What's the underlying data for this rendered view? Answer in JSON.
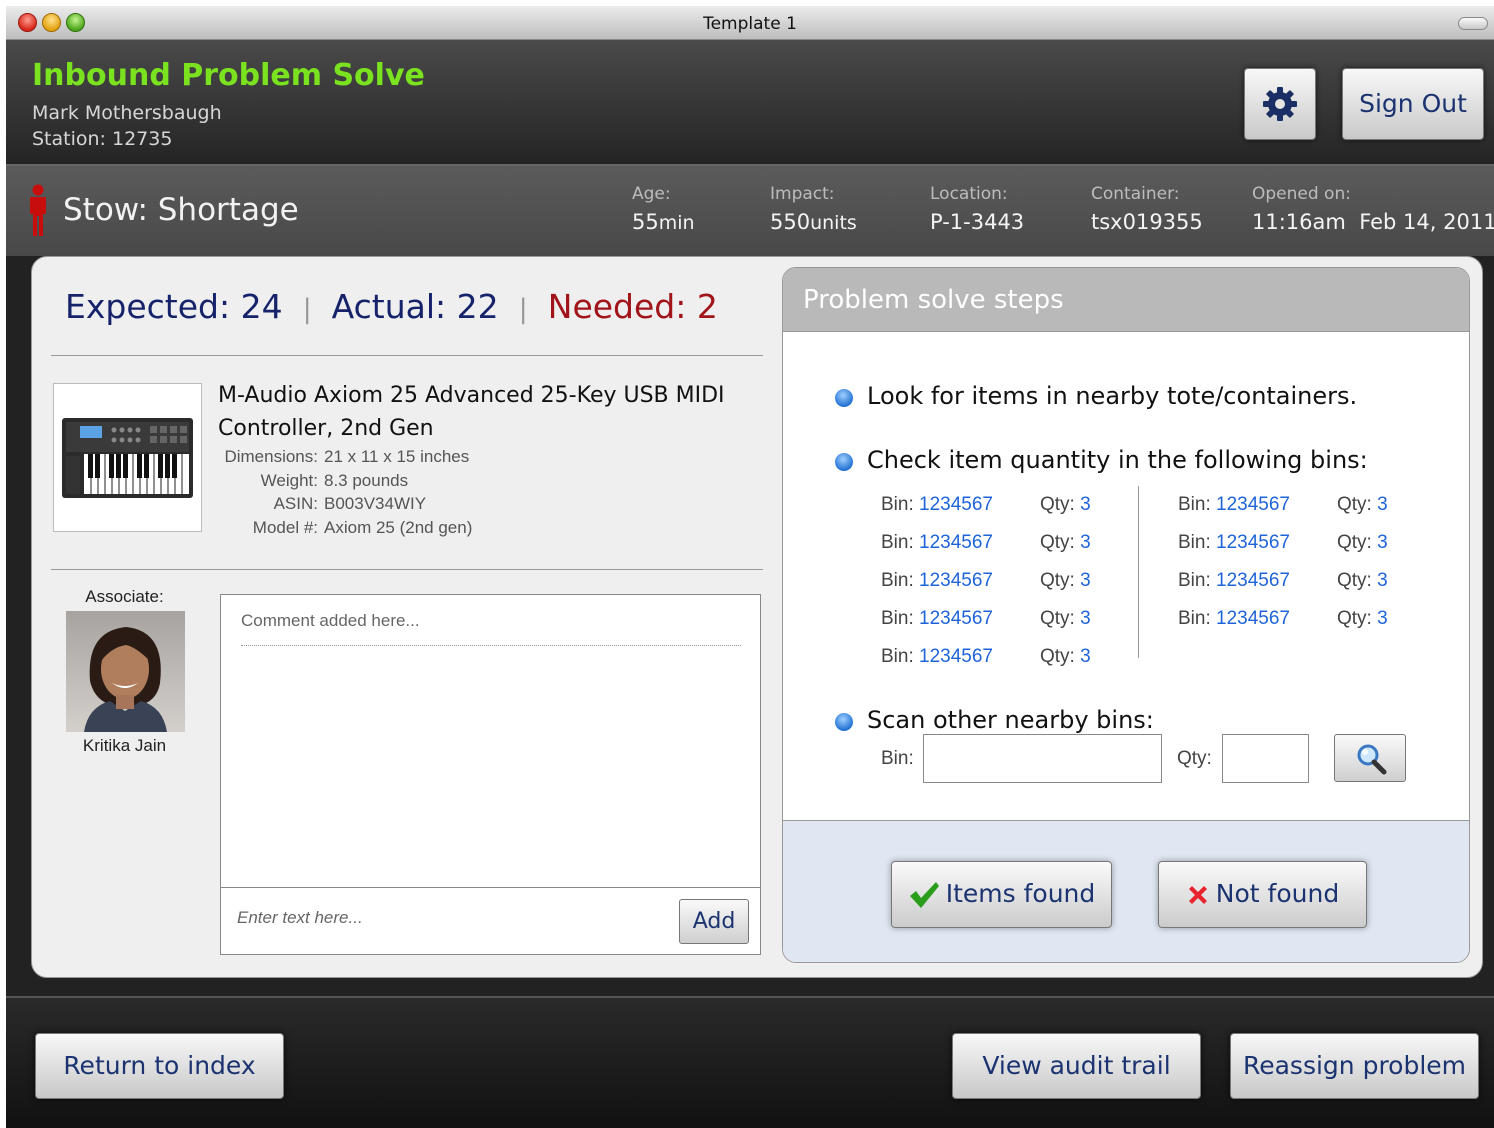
{
  "window": {
    "title": "Template 1"
  },
  "header": {
    "app_title": "Inbound Problem Solve",
    "user_name": "Mark Mothersbaugh",
    "station": "Station: 12735",
    "settings_icon": "gear-icon",
    "sign_out_label": "Sign Out"
  },
  "problem": {
    "type": "Stow: Shortage",
    "age": {
      "label": "Age:",
      "value": "55",
      "unit": "min"
    },
    "impact": {
      "label": "Impact:",
      "value": "550",
      "unit": "units"
    },
    "location": {
      "label": "Location:",
      "value": "P-1-3443"
    },
    "container": {
      "label": "Container:",
      "value": "tsx019355"
    },
    "opened": {
      "label": "Opened on:",
      "value": "11:16am  Feb 14, 2011"
    }
  },
  "counts": {
    "expected": "Expected: 24",
    "actual": "Actual: 22",
    "needed": "Needed: 2",
    "separator": "|"
  },
  "product": {
    "title": "M-Audio Axiom 25 Advanced 25-Key USB MIDI Controller, 2nd Gen",
    "specs": [
      {
        "key": "Dimensions:",
        "value": "21 x 11 x 15 inches"
      },
      {
        "key": "Weight:",
        "value": "8.3 pounds"
      },
      {
        "key": "ASIN:",
        "value": "B003V34WIY"
      },
      {
        "key": "Model #:",
        "value": "Axiom 25 (2nd gen)"
      }
    ]
  },
  "associate": {
    "label": "Associate:",
    "name": "Kritika Jain"
  },
  "comments": {
    "existing": "Comment added here...",
    "input_placeholder": "Enter text here...",
    "add_label": "Add"
  },
  "steps": {
    "title": "Problem solve steps",
    "step1": "Look for items in nearby tote/containers.",
    "step2": "Check item quantity in the following bins:",
    "step3": "Scan other nearby bins:",
    "bin_label": "Bin:",
    "qty_label": "Qty:",
    "bins_left": [
      {
        "bin": "1234567",
        "qty": "3"
      },
      {
        "bin": "1234567",
        "qty": "3"
      },
      {
        "bin": "1234567",
        "qty": "3"
      },
      {
        "bin": "1234567",
        "qty": "3"
      },
      {
        "bin": "1234567",
        "qty": "3"
      }
    ],
    "bins_right": [
      {
        "bin": "1234567",
        "qty": "3"
      },
      {
        "bin": "1234567",
        "qty": "3"
      },
      {
        "bin": "1234567",
        "qty": "3"
      },
      {
        "bin": "1234567",
        "qty": "3"
      }
    ],
    "scan_bin_label": "Bin:",
    "scan_qty_label": "Qty:",
    "scan_bin_value": "",
    "scan_qty_value": "",
    "search_icon": "magnifier-icon",
    "items_found_label": "Items found",
    "not_found_label": "Not found"
  },
  "footer": {
    "return_label": "Return to index",
    "audit_label": "View audit trail",
    "reassign_label": "Reassign problem"
  },
  "colors": {
    "app_title": "#7be21f",
    "expected": "#16236b",
    "needed": "#a0141a",
    "link": "#1e64d8",
    "button_text": "#1b3370"
  }
}
